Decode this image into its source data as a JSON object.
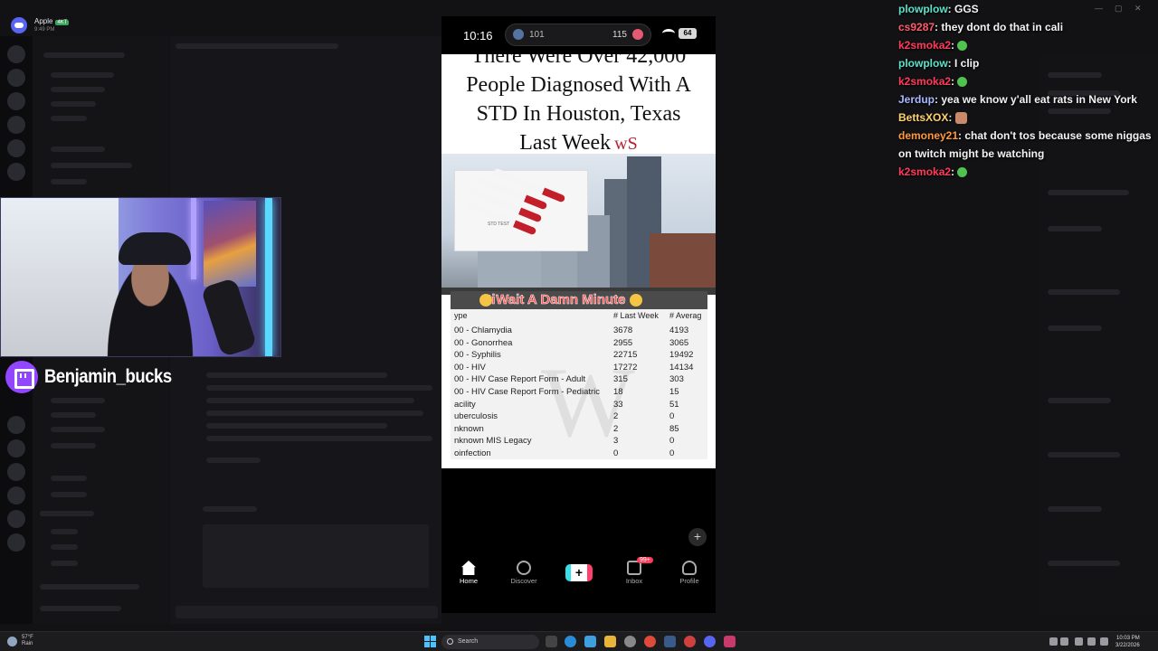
{
  "discord": {
    "app_name": "Apple",
    "app_badge": "4KT",
    "app_sub": "9:49 PM"
  },
  "streamer": {
    "name": "Benjamin_bucks"
  },
  "phone": {
    "time": "10:16",
    "island_left": "101",
    "island_right": "115",
    "battery": "64",
    "headline": [
      "There Were Over 42,000",
      "People Diagnosed With A",
      "STD In Houston, Texas",
      "Last Week"
    ],
    "logo": "ᴡS",
    "tube_label": "STD TEST",
    "table_title": "Wait A Damn Minute",
    "table_cut_label": "cti",
    "table_type_label": "ype",
    "table_headers": [
      "# Last Week",
      "# Averag"
    ],
    "table_rows": [
      [
        "00 - Chlamydia",
        "3678",
        "4193"
      ],
      [
        "00 - Gonorrhea",
        "2955",
        "3065"
      ],
      [
        "00 - Syphilis",
        "22715",
        "19492"
      ],
      [
        "00 - HIV",
        "17272",
        "14134"
      ],
      [
        "00 - HIV Case Report Form - Adult",
        "315",
        "303"
      ],
      [
        "00 - HIV Case Report Form - Pediatric",
        "18",
        "15"
      ],
      [
        "acility",
        "33",
        "51"
      ],
      [
        "uberculosis",
        "2",
        "0"
      ],
      [
        "nknown",
        "2",
        "85"
      ],
      [
        "nknown MIS Legacy",
        "3",
        "0"
      ],
      [
        "oinfection",
        "0",
        "0"
      ]
    ],
    "tabs": [
      {
        "label": "Home"
      },
      {
        "label": "Discover"
      },
      {
        "label": "+"
      },
      {
        "label": "Inbox",
        "badge": "99+"
      },
      {
        "label": "Profile"
      }
    ]
  },
  "chat": [
    {
      "user": "plowplow",
      "color": "#5ee0c8",
      "text": "GGS",
      "emote": ""
    },
    {
      "user": "cs9287",
      "color": "#ff5b6b",
      "text": "they dont do that in cali",
      "emote": ""
    },
    {
      "user": "k2smoka2",
      "color": "#ff3a5a",
      "text": "",
      "emote": "green"
    },
    {
      "user": "plowplow",
      "color": "#5ee0c8",
      "text": "I clip",
      "emote": ""
    },
    {
      "user": "k2smoka2",
      "color": "#ff3a5a",
      "text": "",
      "emote": "green"
    },
    {
      "user": "Jerdup",
      "color": "#a9b8ff",
      "text": "yea we know y'all eat rats in New York",
      "emote": ""
    },
    {
      "user": "BettsXOX",
      "color": "#ffd36b",
      "text": "",
      "emote": "face"
    },
    {
      "user": "demoney21",
      "color": "#ff9a3c",
      "text": "chat don't tos because some niggas on twitch might be watching",
      "emote": ""
    },
    {
      "user": "k2smoka2",
      "color": "#ff3a5a",
      "text": "",
      "emote": "green"
    }
  ],
  "taskbar": {
    "temp": "57°F",
    "weather": "Rain",
    "search": "Search",
    "time": "10:03 PM",
    "date": "3/22/2026"
  }
}
